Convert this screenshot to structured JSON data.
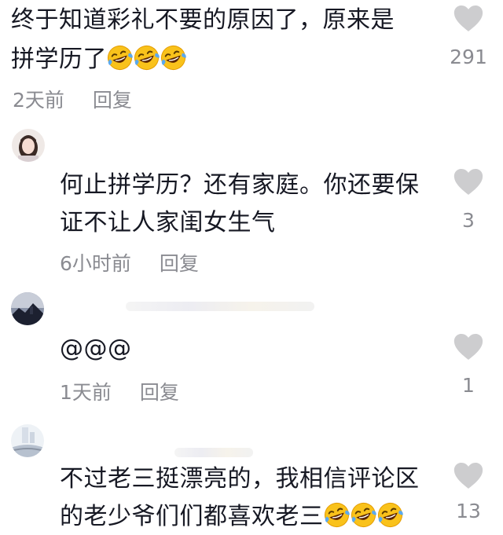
{
  "comments": [
    {
      "text_line1": "终于知道彩礼不要的原因了，原来是",
      "text_line2": "拼学历了",
      "time": "2天前",
      "reply": "回复",
      "likes": "291",
      "emoji_count": 3
    },
    {
      "text_line1": "何止拼学历？还有家庭。你还要保",
      "text_line2": "证不让人家闺女生气",
      "time": "6小时前",
      "reply": "回复",
      "likes": "3"
    },
    {
      "text_line1": "@@@",
      "time": "1天前",
      "reply": "回复",
      "likes": "1"
    },
    {
      "text_line1": "不过老三挺漂亮的，我相信评论区",
      "text_line2": "的老少爷们们都喜欢老三",
      "likes": "13",
      "emoji_count": 3
    }
  ],
  "icons": {
    "like": "heart-icon",
    "emoji": "rofl-emoji-icon"
  },
  "colors": {
    "text": "#161823",
    "meta": "#8a8b91",
    "heart": "#cdcdcf",
    "emoji_face": "#f9c21b",
    "emoji_tear": "#5aa9ef"
  }
}
